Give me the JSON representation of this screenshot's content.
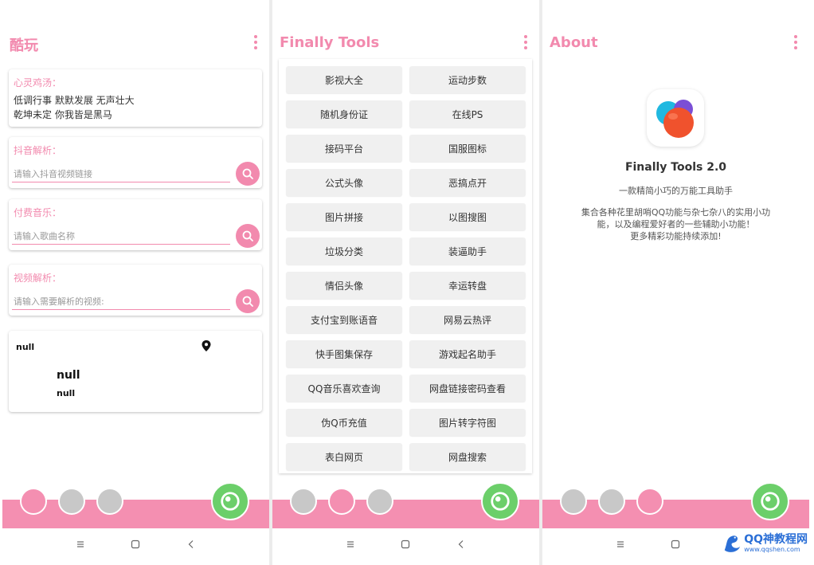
{
  "colors": {
    "accent": "#f28aae",
    "bar": "#f48fb1",
    "fab": "#6ccf6a",
    "dot_inactive": "#c8c8c8"
  },
  "screen1": {
    "title": "酷玩",
    "quote_card": {
      "label": "心灵鸡汤：",
      "line1": "低调行事 默默发展 无声壮大",
      "line2": "乾坤未定 你我皆是黑马"
    },
    "douyin_card": {
      "label": "抖音解析：",
      "placeholder": "请输入抖音视频链接"
    },
    "music_card": {
      "label": "付费音乐：",
      "placeholder": "请输入歌曲名称"
    },
    "video_card": {
      "label": "视频解析：",
      "placeholder": "请输入需要解析的视频:"
    },
    "weather_card": {
      "city": "null",
      "main": "null",
      "sub": "null"
    }
  },
  "screen2": {
    "title": "Finally Tools",
    "tools": [
      [
        "影视大全",
        "运动步数"
      ],
      [
        "随机身份证",
        "在线PS"
      ],
      [
        "接码平台",
        "国服图标"
      ],
      [
        "公式头像",
        "恶搞点开"
      ],
      [
        "图片拼接",
        "以图搜图"
      ],
      [
        "垃圾分类",
        "装逼助手"
      ],
      [
        "情侣头像",
        "幸运转盘"
      ],
      [
        "支付宝到账语音",
        "网易云热评"
      ],
      [
        "快手图集保存",
        "游戏起名助手"
      ],
      [
        "QQ音乐喜欢查询",
        "网盘链接密码查看"
      ],
      [
        "伪Q币充值",
        "图片转字符图"
      ],
      [
        "表白网页",
        "网盘搜索"
      ]
    ]
  },
  "screen3": {
    "title": "About",
    "app_name": "Finally Tools 2.0",
    "subtitle": "一款精简小巧的万能工具助手",
    "desc_line1": "集合各种花里胡哨QQ功能与杂七杂八的实用小功",
    "desc_line2": "能，以及编程爱好者的一些辅助小功能！",
    "desc_line3": "更多精彩功能持续添加!"
  },
  "watermark": {
    "name": "QQ神教程网",
    "url": "www.qqshen.com"
  },
  "icons": [
    "kebab-menu-icon",
    "search-icon",
    "location-pin-icon",
    "fab-icon",
    "nav-menu-icon",
    "nav-home-icon",
    "nav-back-icon",
    "app-logo-icon"
  ]
}
